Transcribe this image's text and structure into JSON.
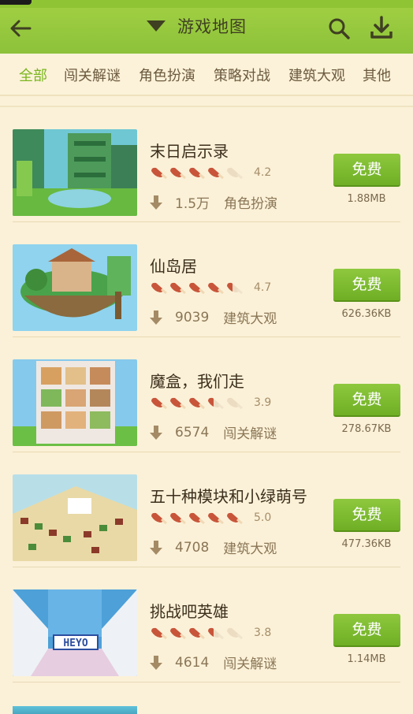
{
  "header": {
    "title": "游戏地图",
    "colors": {
      "bar": "#8cc23a",
      "icon": "#3f3f22"
    },
    "icons": [
      "back-arrow-icon",
      "dropdown-triangle-icon",
      "search-icon",
      "download-icon"
    ]
  },
  "tabs": [
    {
      "label": "全部",
      "active": true
    },
    {
      "label": "闯关解谜",
      "active": false
    },
    {
      "label": "角色扮演",
      "active": false
    },
    {
      "label": "策略对战",
      "active": false
    },
    {
      "label": "建筑大观",
      "active": false
    },
    {
      "label": "其他",
      "active": false
    }
  ],
  "items": [
    {
      "name": "末日启示录",
      "rating": "4.2",
      "stars_filled": 4,
      "downloads": "1.5万",
      "category": "角色扮演",
      "button": "免费",
      "size": "1.88MB"
    },
    {
      "name": "仙岛居",
      "rating": "4.7",
      "stars_filled": 4.5,
      "downloads": "9039",
      "category": "建筑大观",
      "button": "免费",
      "size": "626.36KB"
    },
    {
      "name": "魔盒，我们走",
      "rating": "3.9",
      "stars_filled": 3.5,
      "downloads": "6574",
      "category": "闯关解谜",
      "button": "免费",
      "size": "278.67KB"
    },
    {
      "name": "五十种模块和小绿萌号",
      "rating": "5.0",
      "stars_filled": 5,
      "downloads": "4708",
      "category": "建筑大观",
      "button": "免费",
      "size": "477.36KB"
    },
    {
      "name": "挑战吧英雄",
      "rating": "3.8",
      "stars_filled": 3.5,
      "downloads": "4614",
      "category": "闯关解谜",
      "button": "免费",
      "size": "1.14MB",
      "thumb_text": "HEYO"
    }
  ],
  "theme": {
    "accent": "#7ab51f",
    "button": "#7cbc2e",
    "background": "#fbf1d8",
    "meat": "#c8553a"
  }
}
